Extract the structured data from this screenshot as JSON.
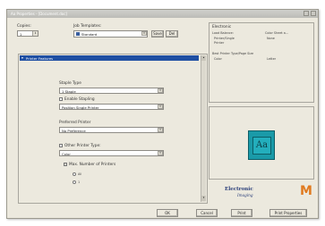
{
  "window": {
    "title": "Aa Properties - [Document.doc]"
  },
  "copies": {
    "label": "Copies:",
    "value": "1"
  },
  "job_templates": {
    "label": "Job Templates:",
    "value": "Standard"
  },
  "template_buttons": {
    "save": "Save",
    "delete": "Del"
  },
  "tree": {
    "header": "Printer Features",
    "stapling": {
      "label": "Staple Type",
      "value": "1 Staple"
    },
    "staple_option": {
      "label": "Enable Stapling",
      "value": "Position Single Printer"
    },
    "preferred_printer": {
      "label": "Preferred Printer",
      "value": "No Preference"
    },
    "printer_type": {
      "label": "Other Printer Type:",
      "value": "Color"
    },
    "max_printers": {
      "label": "Max. Number of Printers",
      "option_all": "All",
      "option_count": "1"
    }
  },
  "status": {
    "title": "Electronic",
    "load_balance": {
      "label": "Load Balance:",
      "value": "Printer/Single",
      "value2": "Printer"
    },
    "color_sheet": {
      "label": "Color Sheet a...",
      "value": "None"
    },
    "row2": {
      "label": "Best Printer Type/Page Size",
      "value": "Color",
      "value2": "Letter"
    }
  },
  "preview": {
    "text": "Aa",
    "page_color": "#1a9aa8"
  },
  "logo": {
    "line1": "Electronic",
    "line2": "Imaging",
    "mark": "M",
    "mark_color": "#e07a1f"
  },
  "buttons": {
    "ok": "OK",
    "cancel": "Cancel",
    "print": "Print",
    "printer_props": "Print Properties"
  }
}
